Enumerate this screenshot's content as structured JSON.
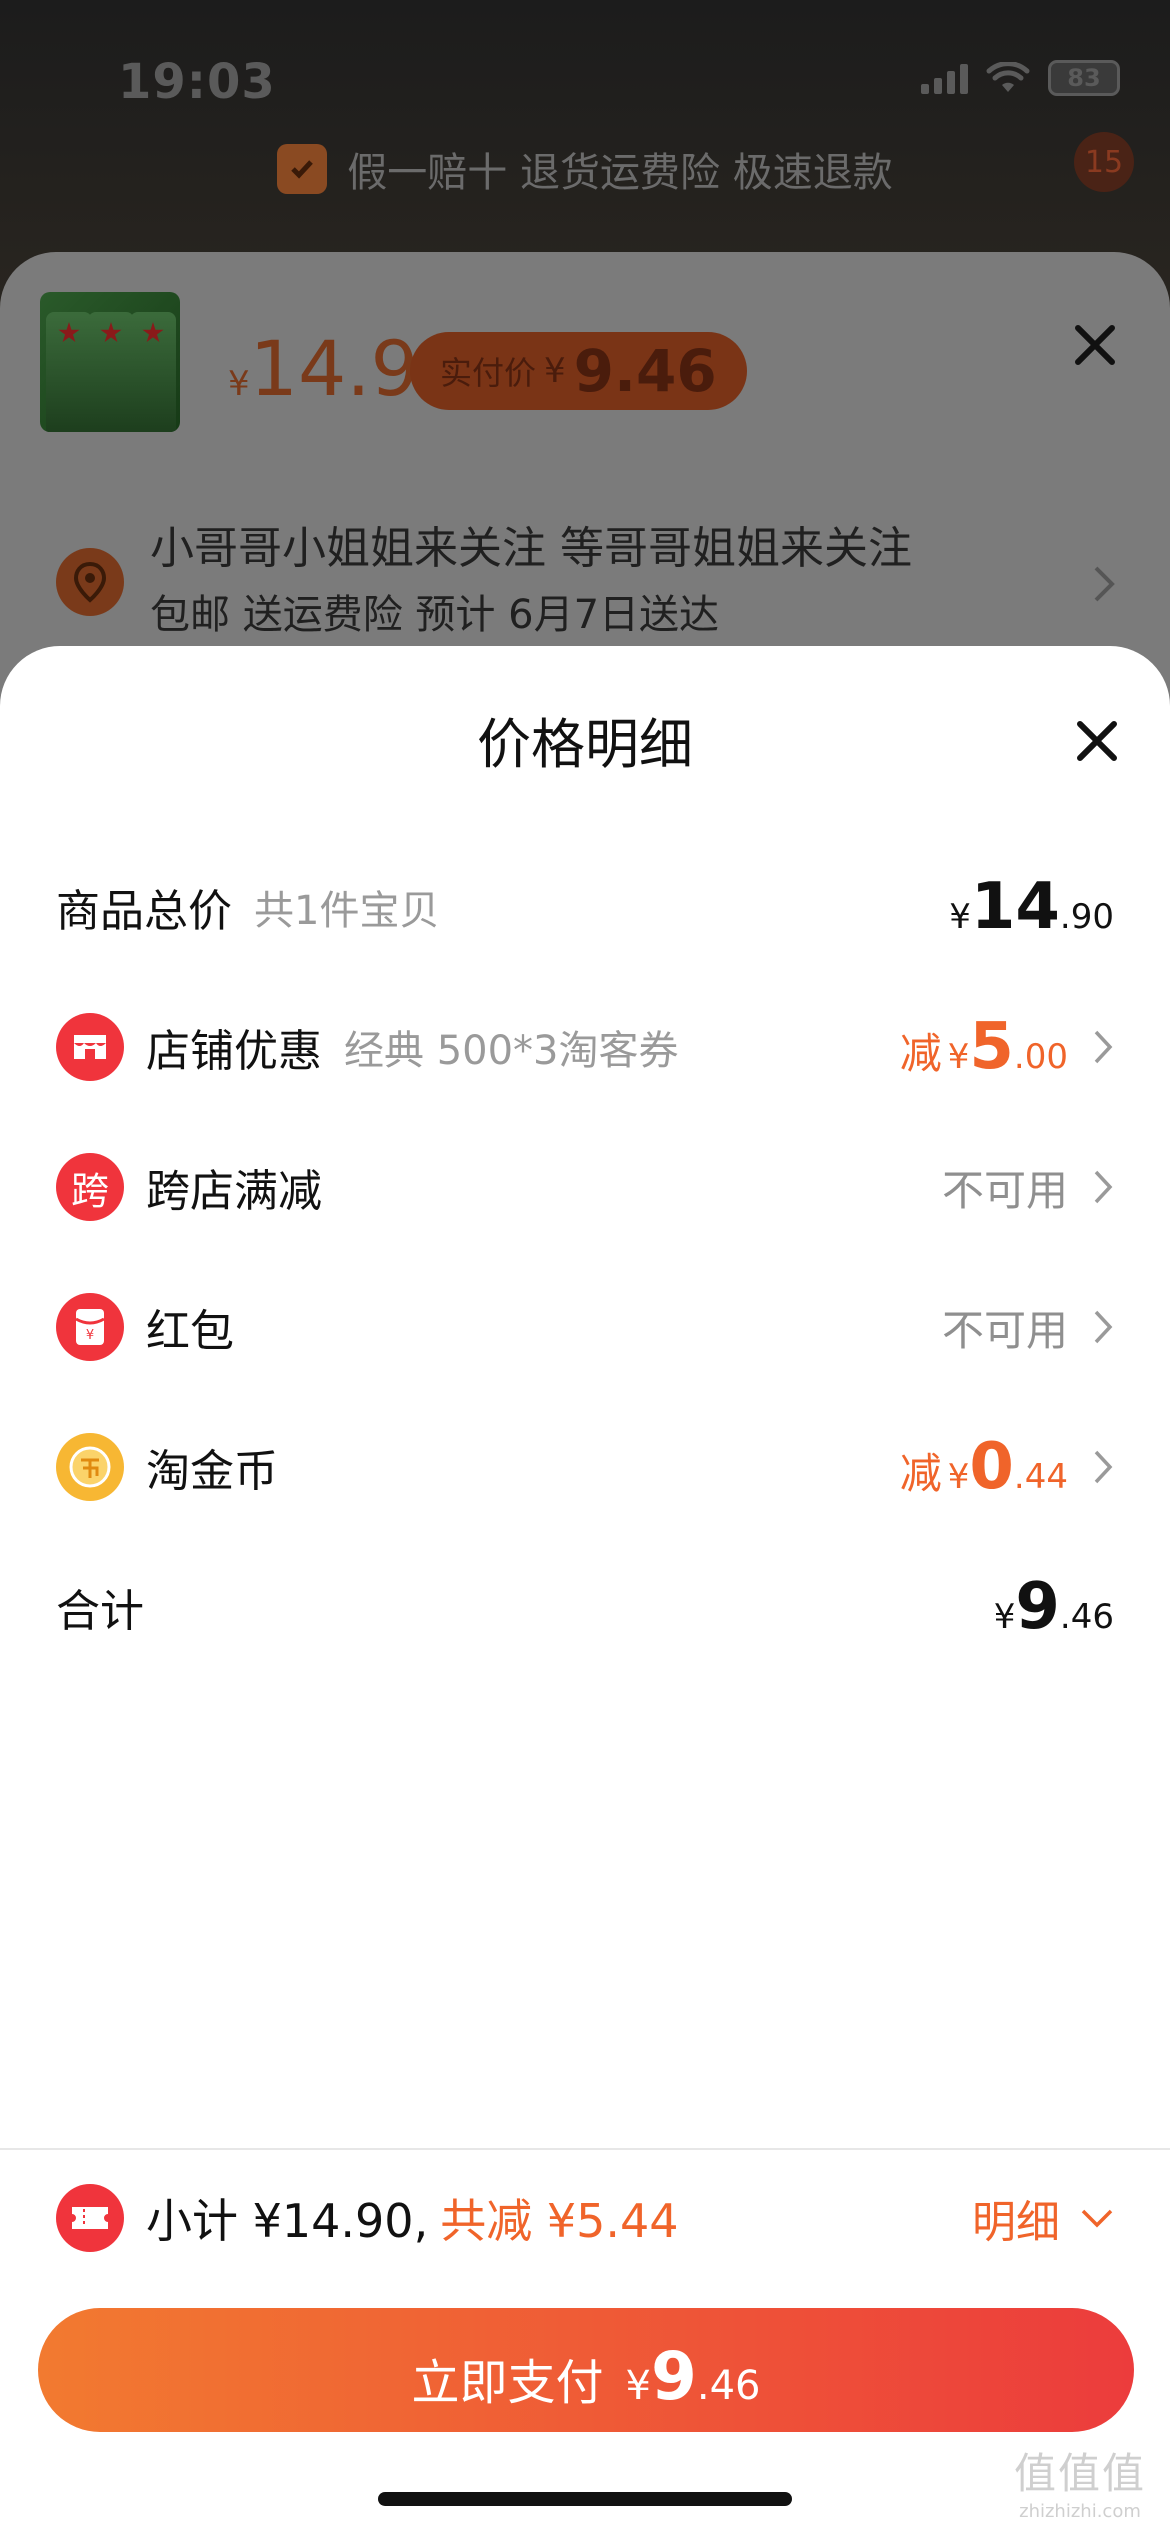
{
  "status": {
    "time": "19:03",
    "battery": "83"
  },
  "guarantee": {
    "text": "假一赔十 退货运费险 极速退款"
  },
  "notif_badge": "15",
  "product": {
    "currency": "¥",
    "price": "14.9",
    "actual_label": "实付价",
    "actual_currency": "¥",
    "actual_price": "9.46"
  },
  "address": {
    "line1": "小哥哥小姐姐来关注 等哥哥姐姐来关注",
    "line2": "包邮  送运费险  预计 6月7日送达"
  },
  "sheet": {
    "title": "价格明细",
    "rows": [
      {
        "label": "商品总价",
        "sub": "共1件宝贝",
        "currency": "¥",
        "int": "14",
        "dec": ".90"
      },
      {
        "label": "店铺优惠",
        "sub": "经典 500*3淘客券",
        "prefix": "减",
        "currency": "¥",
        "int": "5",
        "dec": ".00"
      },
      {
        "label": "跨店满减",
        "icon_text": "跨",
        "status": "不可用"
      },
      {
        "label": "红包",
        "status": "不可用"
      },
      {
        "label": "淘金币",
        "prefix": "减",
        "currency": "¥",
        "int": "0",
        "dec": ".44"
      },
      {
        "label": "合计",
        "currency": "¥",
        "int": "9",
        "dec": ".46"
      }
    ]
  },
  "summary": {
    "subtotal": "小计 ¥14.90,",
    "saved": "共减 ¥5.44",
    "detail": "明细"
  },
  "pay": {
    "label": "立即支付",
    "currency": "¥",
    "int": "9",
    "dec": ".46"
  },
  "watermark": {
    "big": "值值值",
    "small": "zhizhizhi.com"
  }
}
